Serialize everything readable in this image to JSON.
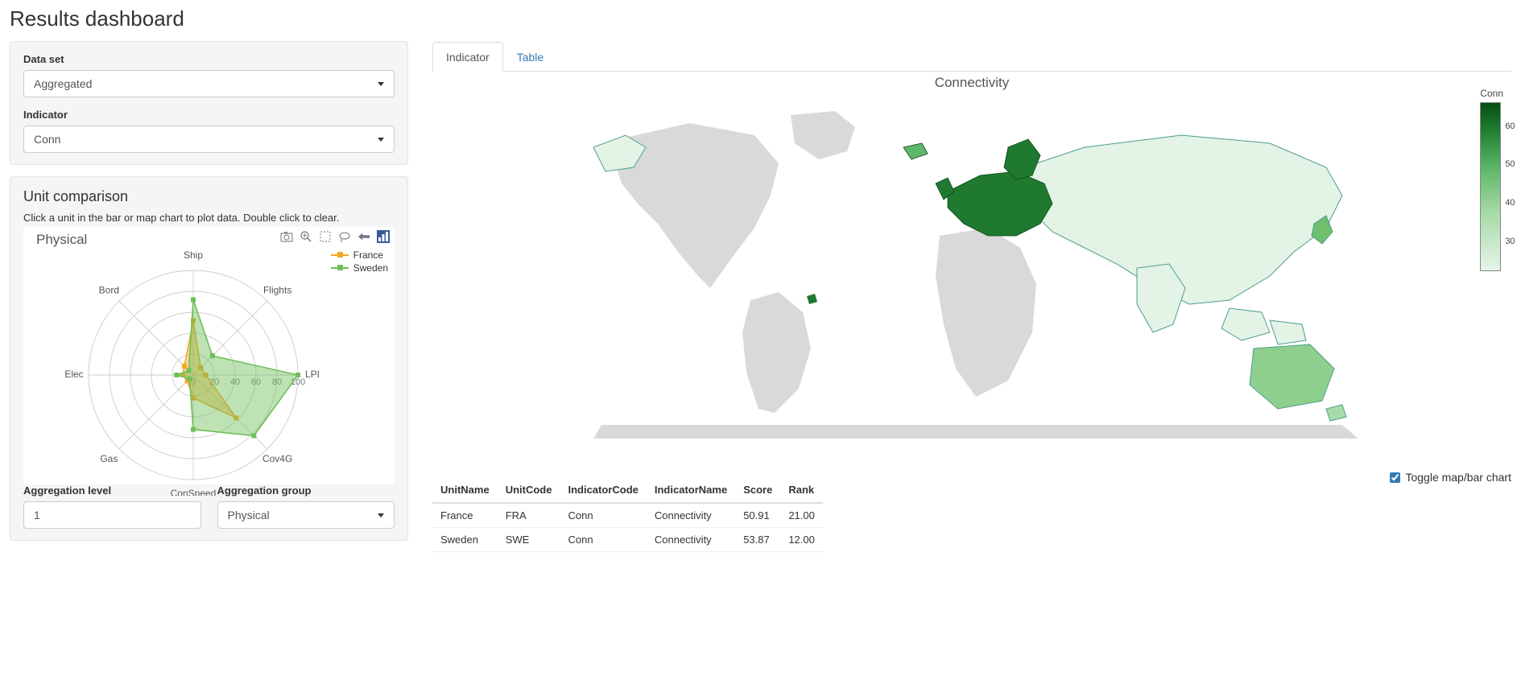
{
  "page_title": "Results dashboard",
  "left": {
    "dataset_label": "Data set",
    "dataset_value": "Aggregated",
    "indicator_label": "Indicator",
    "indicator_value": "Conn",
    "unit_comparison_title": "Unit comparison",
    "unit_comparison_hint": "Click a unit in the bar or map chart to plot data. Double click to clear.",
    "agg_level_label": "Aggregation level",
    "agg_level_value": "1",
    "agg_group_label": "Aggregation group",
    "agg_group_value": "Physical"
  },
  "chart_data": {
    "type": "radar",
    "title": "Physical",
    "categories": [
      "Ship",
      "Flights",
      "LPI",
      "Cov4G",
      "ConSpeed",
      "Gas",
      "Elec",
      "Bord"
    ],
    "series": [
      {
        "name": "France",
        "color": "#f5a623",
        "values": [
          52,
          10,
          12,
          58,
          22,
          8,
          10,
          12
        ]
      },
      {
        "name": "Sweden",
        "color": "#6fbf58",
        "values": [
          72,
          26,
          100,
          82,
          52,
          5,
          16,
          6
        ]
      }
    ],
    "range": [
      0,
      100
    ],
    "ticks": [
      0,
      20,
      40,
      60,
      80,
      100
    ]
  },
  "tabs": [
    {
      "label": "Indicator",
      "active": true
    },
    {
      "label": "Table",
      "active": false
    }
  ],
  "map": {
    "title": "Connectivity",
    "legend_title": "Conn",
    "colorbar_ticks": [
      30,
      40,
      50,
      60
    ],
    "colorbar_range": [
      22,
      66
    ]
  },
  "table": {
    "headers": [
      "UnitName",
      "UnitCode",
      "IndicatorCode",
      "IndicatorName",
      "Score",
      "Rank"
    ],
    "rows": [
      [
        "France",
        "FRA",
        "Conn",
        "Connectivity",
        "50.91",
        "21.00"
      ],
      [
        "Sweden",
        "SWE",
        "Conn",
        "Connectivity",
        "53.87",
        "12.00"
      ]
    ]
  },
  "toggle": {
    "label": "Toggle map/bar chart",
    "checked": true
  },
  "toolbar_icons": [
    "camera",
    "zoom",
    "box-select",
    "lasso",
    "reset",
    "bar"
  ]
}
